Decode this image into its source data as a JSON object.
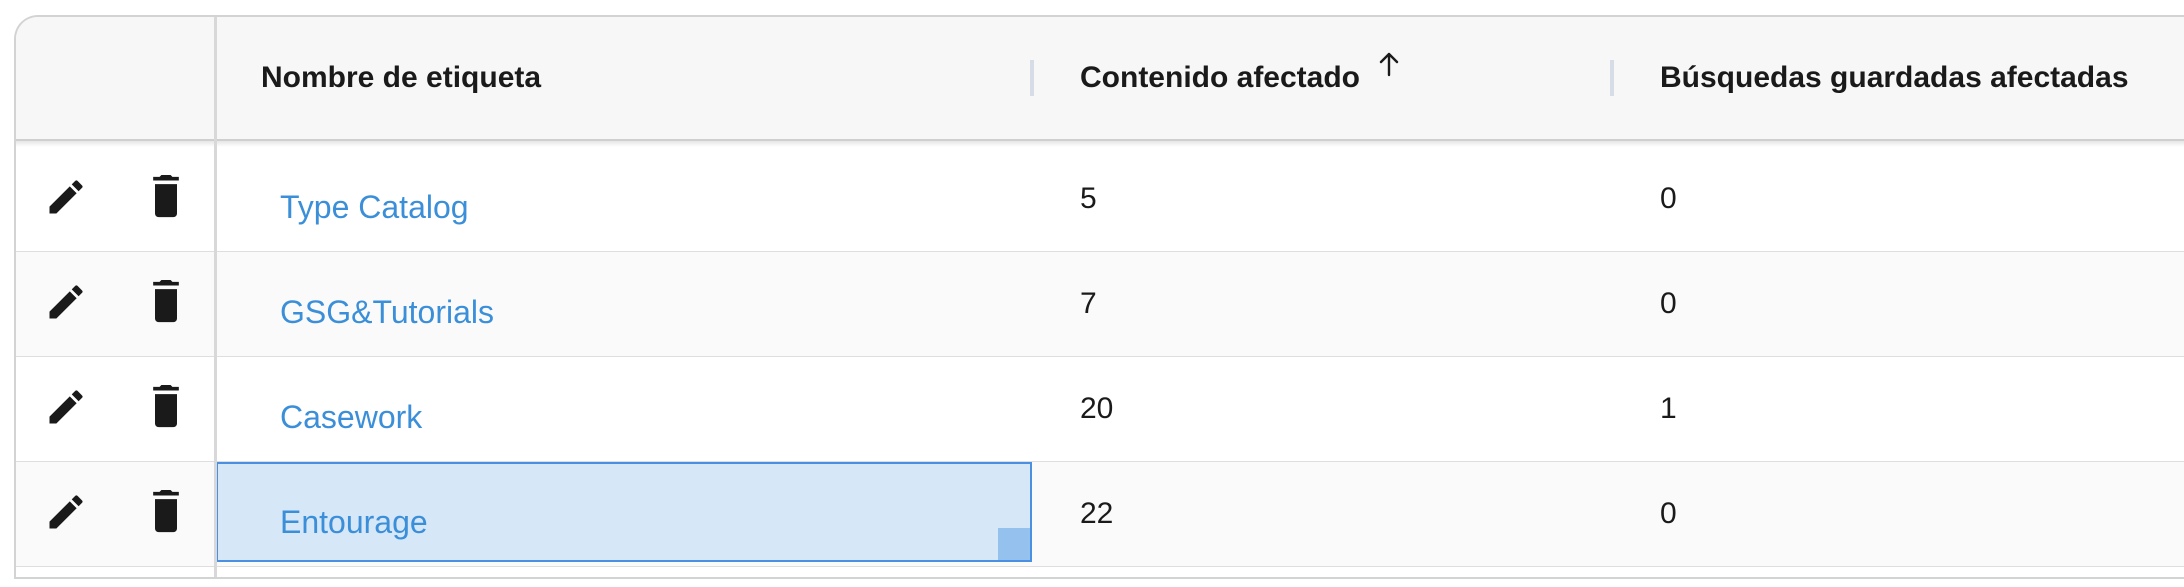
{
  "columns": {
    "name": "Nombre de etiqueta",
    "content": "Contenido afectado",
    "saved": "Búsquedas guardadas afectadas"
  },
  "sort": {
    "column": "Contenido afectado",
    "direction": "ascending"
  },
  "icons": {
    "edit": "pencil-icon",
    "delete": "trash-icon",
    "sort": "arrow-up-icon"
  },
  "colors": {
    "link": "#3b8fd9",
    "selection": "#d6e7f8",
    "selection_border": "#4a90e2"
  },
  "rows": [
    {
      "name": "Type Catalog",
      "content": "5",
      "saved": "0"
    },
    {
      "name": "GSG&Tutorials",
      "content": "7",
      "saved": "0"
    },
    {
      "name": "Casework",
      "content": "20",
      "saved": "1"
    },
    {
      "name": "Entourage",
      "content": "22",
      "saved": "0"
    }
  ],
  "selected_row": "Entourage"
}
